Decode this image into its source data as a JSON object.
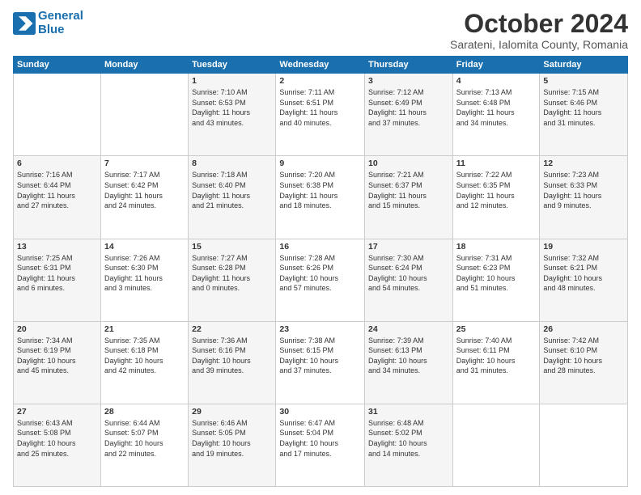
{
  "header": {
    "logo_line1": "General",
    "logo_line2": "Blue",
    "title": "October 2024",
    "subtitle": "Sarateni, Ialomita County, Romania"
  },
  "weekdays": [
    "Sunday",
    "Monday",
    "Tuesday",
    "Wednesday",
    "Thursday",
    "Friday",
    "Saturday"
  ],
  "weeks": [
    [
      {
        "num": "",
        "info": ""
      },
      {
        "num": "",
        "info": ""
      },
      {
        "num": "1",
        "info": "Sunrise: 7:10 AM\nSunset: 6:53 PM\nDaylight: 11 hours\nand 43 minutes."
      },
      {
        "num": "2",
        "info": "Sunrise: 7:11 AM\nSunset: 6:51 PM\nDaylight: 11 hours\nand 40 minutes."
      },
      {
        "num": "3",
        "info": "Sunrise: 7:12 AM\nSunset: 6:49 PM\nDaylight: 11 hours\nand 37 minutes."
      },
      {
        "num": "4",
        "info": "Sunrise: 7:13 AM\nSunset: 6:48 PM\nDaylight: 11 hours\nand 34 minutes."
      },
      {
        "num": "5",
        "info": "Sunrise: 7:15 AM\nSunset: 6:46 PM\nDaylight: 11 hours\nand 31 minutes."
      }
    ],
    [
      {
        "num": "6",
        "info": "Sunrise: 7:16 AM\nSunset: 6:44 PM\nDaylight: 11 hours\nand 27 minutes."
      },
      {
        "num": "7",
        "info": "Sunrise: 7:17 AM\nSunset: 6:42 PM\nDaylight: 11 hours\nand 24 minutes."
      },
      {
        "num": "8",
        "info": "Sunrise: 7:18 AM\nSunset: 6:40 PM\nDaylight: 11 hours\nand 21 minutes."
      },
      {
        "num": "9",
        "info": "Sunrise: 7:20 AM\nSunset: 6:38 PM\nDaylight: 11 hours\nand 18 minutes."
      },
      {
        "num": "10",
        "info": "Sunrise: 7:21 AM\nSunset: 6:37 PM\nDaylight: 11 hours\nand 15 minutes."
      },
      {
        "num": "11",
        "info": "Sunrise: 7:22 AM\nSunset: 6:35 PM\nDaylight: 11 hours\nand 12 minutes."
      },
      {
        "num": "12",
        "info": "Sunrise: 7:23 AM\nSunset: 6:33 PM\nDaylight: 11 hours\nand 9 minutes."
      }
    ],
    [
      {
        "num": "13",
        "info": "Sunrise: 7:25 AM\nSunset: 6:31 PM\nDaylight: 11 hours\nand 6 minutes."
      },
      {
        "num": "14",
        "info": "Sunrise: 7:26 AM\nSunset: 6:30 PM\nDaylight: 11 hours\nand 3 minutes."
      },
      {
        "num": "15",
        "info": "Sunrise: 7:27 AM\nSunset: 6:28 PM\nDaylight: 11 hours\nand 0 minutes."
      },
      {
        "num": "16",
        "info": "Sunrise: 7:28 AM\nSunset: 6:26 PM\nDaylight: 10 hours\nand 57 minutes."
      },
      {
        "num": "17",
        "info": "Sunrise: 7:30 AM\nSunset: 6:24 PM\nDaylight: 10 hours\nand 54 minutes."
      },
      {
        "num": "18",
        "info": "Sunrise: 7:31 AM\nSunset: 6:23 PM\nDaylight: 10 hours\nand 51 minutes."
      },
      {
        "num": "19",
        "info": "Sunrise: 7:32 AM\nSunset: 6:21 PM\nDaylight: 10 hours\nand 48 minutes."
      }
    ],
    [
      {
        "num": "20",
        "info": "Sunrise: 7:34 AM\nSunset: 6:19 PM\nDaylight: 10 hours\nand 45 minutes."
      },
      {
        "num": "21",
        "info": "Sunrise: 7:35 AM\nSunset: 6:18 PM\nDaylight: 10 hours\nand 42 minutes."
      },
      {
        "num": "22",
        "info": "Sunrise: 7:36 AM\nSunset: 6:16 PM\nDaylight: 10 hours\nand 39 minutes."
      },
      {
        "num": "23",
        "info": "Sunrise: 7:38 AM\nSunset: 6:15 PM\nDaylight: 10 hours\nand 37 minutes."
      },
      {
        "num": "24",
        "info": "Sunrise: 7:39 AM\nSunset: 6:13 PM\nDaylight: 10 hours\nand 34 minutes."
      },
      {
        "num": "25",
        "info": "Sunrise: 7:40 AM\nSunset: 6:11 PM\nDaylight: 10 hours\nand 31 minutes."
      },
      {
        "num": "26",
        "info": "Sunrise: 7:42 AM\nSunset: 6:10 PM\nDaylight: 10 hours\nand 28 minutes."
      }
    ],
    [
      {
        "num": "27",
        "info": "Sunrise: 6:43 AM\nSunset: 5:08 PM\nDaylight: 10 hours\nand 25 minutes."
      },
      {
        "num": "28",
        "info": "Sunrise: 6:44 AM\nSunset: 5:07 PM\nDaylight: 10 hours\nand 22 minutes."
      },
      {
        "num": "29",
        "info": "Sunrise: 6:46 AM\nSunset: 5:05 PM\nDaylight: 10 hours\nand 19 minutes."
      },
      {
        "num": "30",
        "info": "Sunrise: 6:47 AM\nSunset: 5:04 PM\nDaylight: 10 hours\nand 17 minutes."
      },
      {
        "num": "31",
        "info": "Sunrise: 6:48 AM\nSunset: 5:02 PM\nDaylight: 10 hours\nand 14 minutes."
      },
      {
        "num": "",
        "info": ""
      },
      {
        "num": "",
        "info": ""
      }
    ]
  ]
}
